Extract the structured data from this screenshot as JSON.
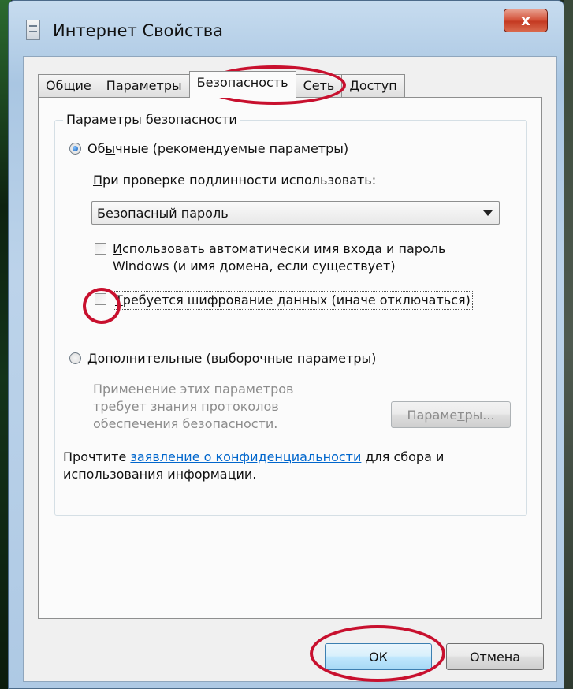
{
  "window": {
    "title": "Интернет Свойства",
    "close_symbol": "x"
  },
  "tabs": [
    {
      "label": "Общие"
    },
    {
      "label": "Параметры"
    },
    {
      "label": "Безопасность",
      "active": true
    },
    {
      "label": "Сеть"
    },
    {
      "label": "Доступ"
    }
  ],
  "security": {
    "group_title": "Параметры безопасности",
    "radio_standard": {
      "pre": "Об",
      "u": "ы",
      "post": "чные (рекомендуемые параметры)"
    },
    "auth_label": {
      "u": "П",
      "post": "ри проверке подлинности использовать:"
    },
    "auth_select_value": "Безопасный пароль",
    "auto_login": {
      "u": "И",
      "line1_post": "спользовать автоматически имя входа и пароль",
      "line2": "Windows (и имя домена, если существует)"
    },
    "encrypt": {
      "u": "Т",
      "post": "ребуется шифрование данных (иначе отключаться)"
    },
    "radio_advanced": {
      "u": "Д",
      "post": "ополнительные (выборочные параметры)"
    },
    "advanced_desc": [
      "Применение этих параметров",
      "требует знания протоколов",
      "обеспечения безопасности."
    ],
    "params_button": {
      "pre": "Параме",
      "u": "т",
      "post": "ры..."
    },
    "privacy": {
      "pre": "Прочтите ",
      "link": "заявление о конфиденциальности",
      "post_line1": " для сбора и",
      "line2": "использования информации."
    }
  },
  "buttons": {
    "ok": "ОК",
    "cancel": "Отмена"
  },
  "colors": {
    "annotation": "#c8102e",
    "link": "#0066cc"
  }
}
